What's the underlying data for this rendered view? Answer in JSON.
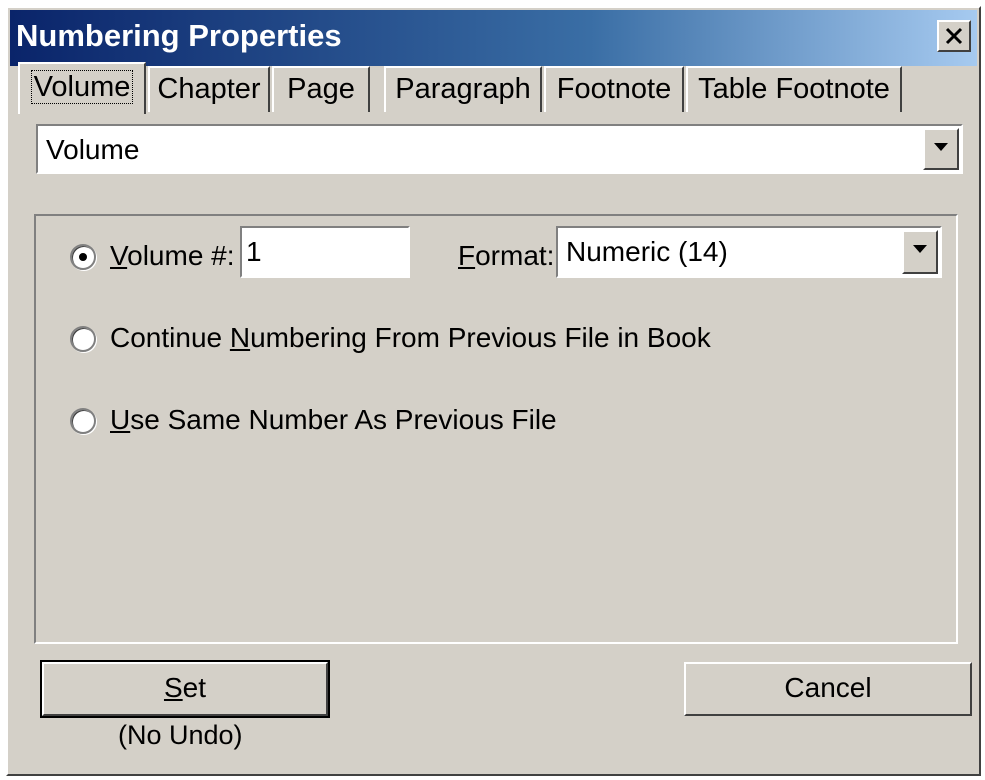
{
  "window": {
    "title": "Numbering Properties"
  },
  "tabs": [
    {
      "label": "Volume"
    },
    {
      "label": "Chapter"
    },
    {
      "label": "Page"
    },
    {
      "label": "Paragraph"
    },
    {
      "label": "Footnote"
    },
    {
      "label": "Table Footnote"
    }
  ],
  "active_tab": "Volume",
  "type_combo": {
    "value": "Volume"
  },
  "options": {
    "volume_number": {
      "label_u": "V",
      "label_rest": "olume #:",
      "value": "1",
      "selected": true
    },
    "format": {
      "label_u": "F",
      "label_rest": "ormat:",
      "value": "Numeric  (14)"
    },
    "continue": {
      "label_pre": "Continue ",
      "label_u": "N",
      "label_rest": "umbering From Previous File in Book",
      "selected": false
    },
    "same": {
      "label_u": "U",
      "label_rest": "se Same Number As Previous File",
      "selected": false
    }
  },
  "buttons": {
    "set": {
      "label_u": "S",
      "label_rest": "et"
    },
    "set_note": "(No Undo)",
    "cancel": "Cancel"
  },
  "icons": {
    "close": "close-icon",
    "dropdown": "chevron-down-icon"
  }
}
